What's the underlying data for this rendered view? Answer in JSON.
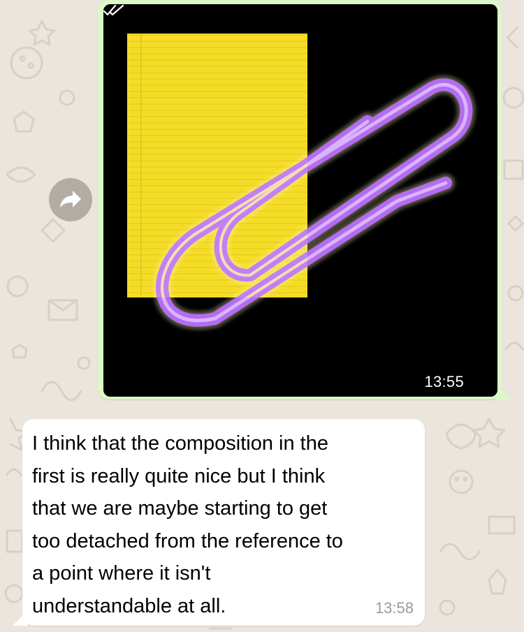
{
  "outgoing_message": {
    "type": "image",
    "time": "13:55",
    "status_icon": "double-check-icon",
    "forward_icon": "forward-arrow-icon"
  },
  "incoming_message": {
    "text": "I think that the composition in the\nfirst is really quite nice but I think\nthat we are maybe starting to get\ntoo detached from the reference to\na point where it isn't\nunderstandable at all.",
    "time": "13:58"
  },
  "colors": {
    "chat_background": "#ece5dd",
    "outgoing_bubble": "#dcf8c6",
    "incoming_bubble": "#ffffff",
    "paper_yellow": "#f5dc26",
    "paperclip_purple": "#b46cf0"
  }
}
